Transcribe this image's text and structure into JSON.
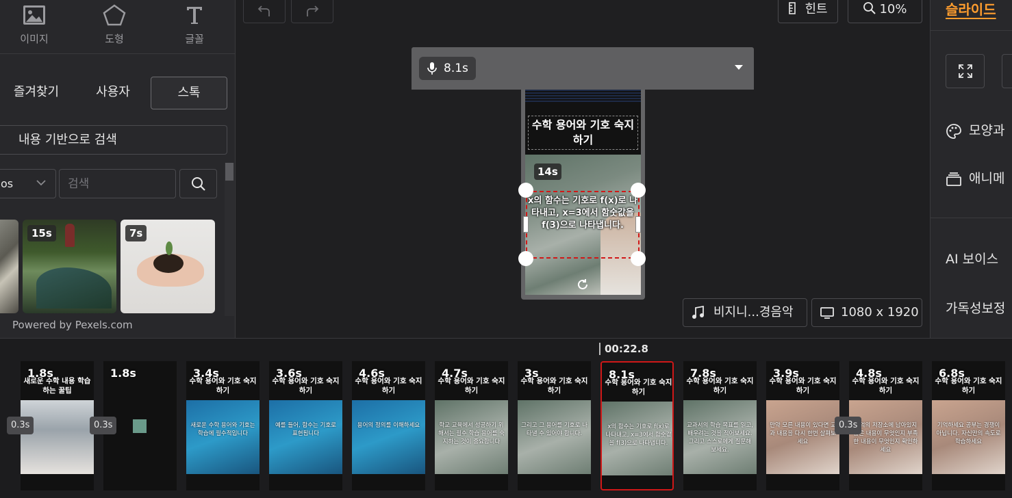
{
  "left_panel": {
    "tools": [
      {
        "label": "이미지",
        "icon": "image-icon"
      },
      {
        "label": "도형",
        "icon": "pentagon-icon"
      },
      {
        "label": "글꼴",
        "icon": "text-icon"
      }
    ],
    "tabs": [
      {
        "label": "즐겨찾기"
      },
      {
        "label": "사용자"
      },
      {
        "label": "스톡"
      }
    ],
    "content_search_label": "내용 기반으로 검색",
    "filter_select_value": "os",
    "search_placeholder": "검색",
    "thumbnails": [
      {
        "duration": ""
      },
      {
        "duration": "15s"
      },
      {
        "duration": "7s"
      }
    ],
    "powered_by": "Powered by Pexels.com"
  },
  "toolbar": {
    "hint_label": "힌트",
    "zoom_label": "10%"
  },
  "voice": {
    "duration": "8.1s"
  },
  "preview": {
    "title": "수학 용어와 기호 숙지하기",
    "scene_duration": "14s",
    "body_text": "x의 함수는 기호로 f(x)로 나타내고, x=3에서 함숫값을 f(3)으로 나타냅니다."
  },
  "bottom_controls": {
    "music_label": "비지니...경음악",
    "resolution_label": "1080 x 1920"
  },
  "right_panel": {
    "slide_tab": "슬라이드",
    "items": [
      {
        "label": "모양과",
        "icon": "palette-icon"
      },
      {
        "label": "애니메",
        "icon": "layers-icon"
      },
      {
        "label": "AI 보이스",
        "icon": ""
      },
      {
        "label": "가독성보정",
        "icon": ""
      }
    ]
  },
  "timeline": {
    "current_time": "00:22.8",
    "transitions": [
      "0.3s",
      "0.3s",
      "0.3s"
    ],
    "clips": [
      {
        "duration": "1.8s",
        "title": "새로운 수학 내용 학습하는 꿀팁",
        "text": ""
      },
      {
        "duration": "1.8s",
        "title": "",
        "text": ""
      },
      {
        "duration": "3.4s",
        "title": "수학 용어와 기호 숙지하기",
        "text": "새로운 수학 용어와 기호는 학습에 필수적입니다"
      },
      {
        "duration": "3.6s",
        "title": "수학 용어와 기호 숙지하기",
        "text": "예를 들어, 함수는 기호로 표현됩니다"
      },
      {
        "duration": "4.6s",
        "title": "수학 용어와 기호 숙지하기",
        "text": "용어의 정의를 이해하세요"
      },
      {
        "duration": "4.7s",
        "title": "수학 용어와 기호 숙지하기",
        "text": "학교 교육에서 성공하기 위해서는 필수 학습 용어를 숙지하는 것이 중요합니다"
      },
      {
        "duration": "3s",
        "title": "수학 용어와 기호 숙지하기",
        "text": "그리고 그 용어를 기호로 나타낼 수 있어야 합니다."
      },
      {
        "duration": "8.1s",
        "title": "수학 용어와 기호 숙지하기",
        "text": "x의 함수는 기호로 f(x)로 나타내고, x=3에서 함숫값을 f(3)으로 나타냅니다."
      },
      {
        "duration": "7.8s",
        "title": "수학 용어와 기호 숙지하기",
        "text": "교과서의 학습 목표를 읽고, 배우려는 것을 적어보세요. 그리고 스스로에게 질문해보세요."
      },
      {
        "duration": "3.9s",
        "title": "수학 용어와 기호 숙지하기",
        "text": "만약 모른 내용이 있다면 교과 내용을 다시 한번 살펴보세요"
      },
      {
        "duration": "4.8s",
        "title": "수학 용어와 기호 숙지하기",
        "text": "기억의 저장소에 남아있지 않은 내용이 무엇인지 부족한 내용이 무엇인지 확인하세요"
      },
      {
        "duration": "6.8s",
        "title": "수학 용어와 기호 숙지하기",
        "text": "기억하세요 공부는 경쟁이 아닙니다. 자신만의 속도로 학습하세요"
      }
    ]
  }
}
